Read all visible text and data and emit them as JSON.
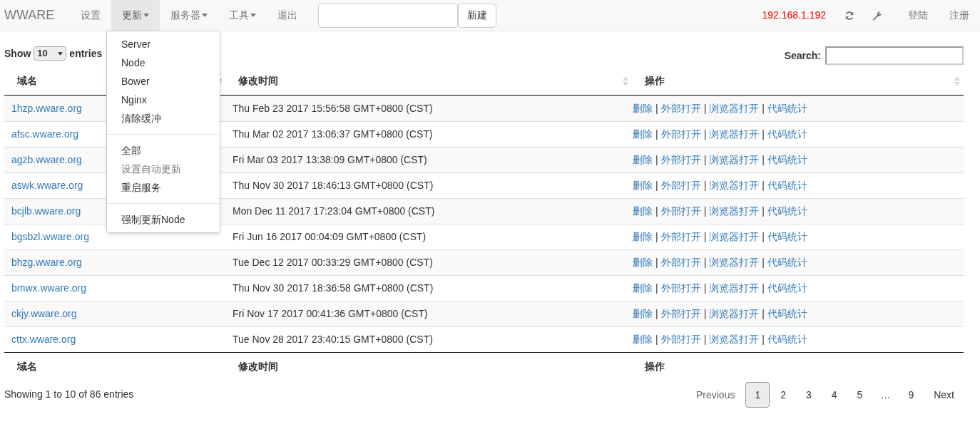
{
  "navbar": {
    "brand": "WWARE",
    "items": [
      {
        "label": "设置",
        "dropdown": false,
        "selected": false
      },
      {
        "label": "更新",
        "dropdown": true,
        "selected": true
      },
      {
        "label": "服务器",
        "dropdown": true,
        "selected": false
      },
      {
        "label": "工具",
        "dropdown": true,
        "selected": false
      },
      {
        "label": "退出",
        "dropdown": false,
        "selected": false
      }
    ],
    "new_button": "新建",
    "ip": "192.168.1.192",
    "right_links": [
      "登陆",
      "注册"
    ]
  },
  "dropdown_menu": [
    [
      {
        "label": "Server",
        "disabled": false
      },
      {
        "label": "Node",
        "disabled": false
      },
      {
        "label": "Bower",
        "disabled": false
      },
      {
        "label": "Nginx",
        "disabled": false
      },
      {
        "label": "清除缓冲",
        "disabled": false
      }
    ],
    [
      {
        "label": "全部",
        "disabled": false
      },
      {
        "label": "设置自动更新",
        "disabled": true
      },
      {
        "label": "重启服务",
        "disabled": false
      }
    ],
    [
      {
        "label": "强制更新Node",
        "disabled": false
      }
    ]
  ],
  "length": {
    "before": "Show",
    "value": "10",
    "after": "entries"
  },
  "search": {
    "label": "Search:"
  },
  "table": {
    "columns": [
      {
        "label": "域名",
        "sorted": true
      },
      {
        "label": "修改时间",
        "sorted": false
      },
      {
        "label": "操作",
        "sorted": false
      }
    ],
    "action_separator": "|",
    "rows": [
      {
        "domain": "1hzp.wware.org",
        "time": "Thu Feb 23 2017 15:56:58 GMT+0800 (CST)",
        "actions": [
          "删除",
          "外部打开",
          "浏览器打开",
          "代码统计"
        ]
      },
      {
        "domain": "afsc.wware.org",
        "time": "Thu Mar 02 2017 13:06:37 GMT+0800 (CST)",
        "actions": [
          "删除",
          "外部打开",
          "浏览器打开",
          "代码统计"
        ]
      },
      {
        "domain": "agzb.wware.org",
        "time": "Fri Mar 03 2017 13:38:09 GMT+0800 (CST)",
        "actions": [
          "删除",
          "外部打开",
          "浏览器打开",
          "代码统计"
        ]
      },
      {
        "domain": "aswk.wware.org",
        "time": "Thu Nov 30 2017 18:46:13 GMT+0800 (CST)",
        "actions": [
          "删除",
          "外部打开",
          "浏览器打开",
          "代码统计"
        ]
      },
      {
        "domain": "bcjlb.wware.org",
        "time": "Mon Dec 11 2017 17:23:04 GMT+0800 (CST)",
        "actions": [
          "删除",
          "外部打开",
          "浏览器打开",
          "代码统计"
        ]
      },
      {
        "domain": "bgsbzl.wware.org",
        "time": "Fri Jun 16 2017 00:04:09 GMT+0800 (CST)",
        "actions": [
          "删除",
          "外部打开",
          "浏览器打开",
          "代码统计"
        ]
      },
      {
        "domain": "bhzg.wware.org",
        "time": "Tue Dec 12 2017 00:33:29 GMT+0800 (CST)",
        "actions": [
          "删除",
          "外部打开",
          "浏览器打开",
          "代码统计"
        ]
      },
      {
        "domain": "bmwx.wware.org",
        "time": "Thu Nov 30 2017 18:36:58 GMT+0800 (CST)",
        "actions": [
          "删除",
          "外部打开",
          "浏览器打开",
          "代码统计"
        ]
      },
      {
        "domain": "ckjy.wware.org",
        "time": "Fri Nov 17 2017 00:41:36 GMT+0800 (CST)",
        "actions": [
          "删除",
          "外部打开",
          "浏览器打开",
          "代码统计"
        ]
      },
      {
        "domain": "cttx.wware.org",
        "time": "Tue Nov 28 2017 23:40:15 GMT+0800 (CST)",
        "actions": [
          "删除",
          "外部打开",
          "浏览器打开",
          "代码统计"
        ]
      }
    ],
    "footer_columns": [
      "域名",
      "修改时间",
      "操作"
    ]
  },
  "info": "Showing 1 to 10 of 86 entries",
  "pagination": [
    {
      "label": "Previous",
      "kind": "nav",
      "selected": false
    },
    {
      "label": "1",
      "kind": "page",
      "selected": true
    },
    {
      "label": "2",
      "kind": "page",
      "selected": false
    },
    {
      "label": "3",
      "kind": "page",
      "selected": false
    },
    {
      "label": "4",
      "kind": "page",
      "selected": false
    },
    {
      "label": "5",
      "kind": "page",
      "selected": false
    },
    {
      "label": "…",
      "kind": "ellipsis"
    },
    {
      "label": "9",
      "kind": "page",
      "selected": false
    },
    {
      "label": "Next",
      "kind": "nav",
      "selected": false
    }
  ]
}
